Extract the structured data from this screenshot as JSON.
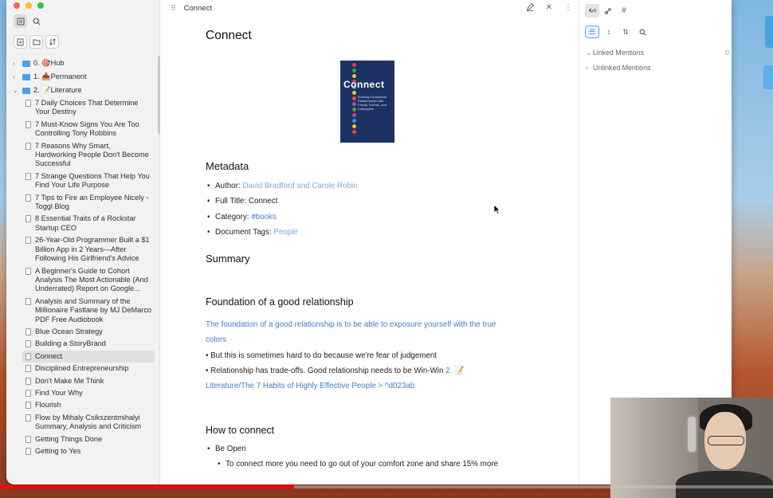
{
  "window": {
    "tab_title": "Connect"
  },
  "sidebar": {
    "folders": [
      {
        "label": "0. 🎯Hub",
        "expanded": false
      },
      {
        "label": "1. 📥Permanent",
        "expanded": false
      },
      {
        "label": "2. 📝Literature",
        "expanded": true
      }
    ],
    "files": [
      "7 Daily Choices That Determine Your Destiny",
      "7 Must-Know Signs You Are Too Controlling Tony Robbins",
      "7 Reasons Why Smart, Hardworking People Don't Become Successful",
      "7 Strange Questions That Help You Find Your Life Purpose",
      "7 Tips to Fire an Employee Nicely - Toggl Blog",
      "8 Essential Traits of a Rockstar Startup CEO",
      "26-Year-Old Programmer Built a $1 Billion App in 2 Years—After Following His Girlfriend's Advice",
      "A Beginner's Guide to Cohort Analysis The Most Actionable (And Underrated) Report on Google...",
      "Analysis and Summary of the Millionaire Fastlane by MJ DeMarco PDF Free Audiobook",
      "Blue Ocean Strategy",
      "Building a StoryBrand",
      "Connect",
      "Disciplined Entrepreneurship",
      "Don't Make Me Think",
      "Find Your Why",
      "Flourish",
      "Flow by Mihaly Csikszentmihalyi Summary, Analysis and Criticism",
      "Getting Things Done",
      "Getting to Yes"
    ],
    "selected_file": "Connect"
  },
  "note": {
    "title": "Connect",
    "cover": {
      "title": "Connect",
      "subtitle": "Building Exceptional Relationships with Family, Friends, and Colleagues"
    },
    "metadata_heading": "Metadata",
    "metadata": {
      "author_label": "Author:",
      "author_value": "David Bradford and Carole Robin",
      "full_title_label": "Full Title:",
      "full_title_value": "Connect",
      "category_label": "Category:",
      "category_value": "#books",
      "tags_label": "Document Tags:",
      "tags_value": "People"
    },
    "summary_heading": "Summary",
    "foundation_heading": "Foundation of a good relationship",
    "foundation_line1": "The foundation of a good relationship is to be able to exposure yourself with the true",
    "foundation_line2": "colors",
    "foundation_bullet1": "• But this is sometimes hard to do because we're fear of judgement",
    "foundation_bullet2_text": "• Relationship has trade-offs. Good relationship needs to be Win-Win ",
    "foundation_bullet2_link1": "2. 📝",
    "foundation_bullet2_link2": "Literature/The 7 Habits of Highly Effective People > ^d023ab",
    "how_heading": "How to connect",
    "how_bullet1": "Be Open",
    "how_subbullet1": "To connect more you need to go out of your comfort zone and share 15% more"
  },
  "right_panel": {
    "linked_label": "Linked Mentions",
    "linked_count": "0",
    "unlinked_label": "Unlinked Mentions"
  },
  "video": {
    "progress": 0.38
  },
  "colors": {
    "link": "#7fa7df",
    "tag": "#3d7fd2",
    "folder": "#4aa0e6"
  }
}
